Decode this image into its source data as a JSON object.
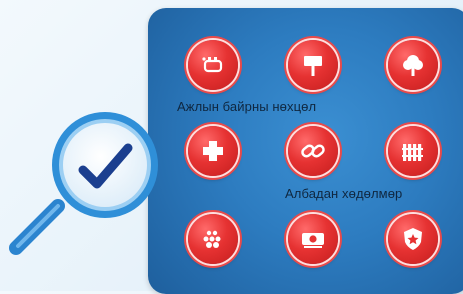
{
  "labels": {
    "working_conditions": "Ажлын байрны нөхцөл",
    "forced_labor": "Албадан хөдөлмөр"
  },
  "icons": [
    "bus-icon",
    "signpost-icon",
    "tree-icon",
    "medical-cross-icon",
    "chain-link-icon",
    "fence-icon",
    "grains-icon",
    "money-icon",
    "police-badge-icon"
  ],
  "colors": {
    "panel": "#2d7cc0",
    "button": "#e63232",
    "magnifier": "#2f8fd8",
    "check": "#1b3f8f"
  }
}
